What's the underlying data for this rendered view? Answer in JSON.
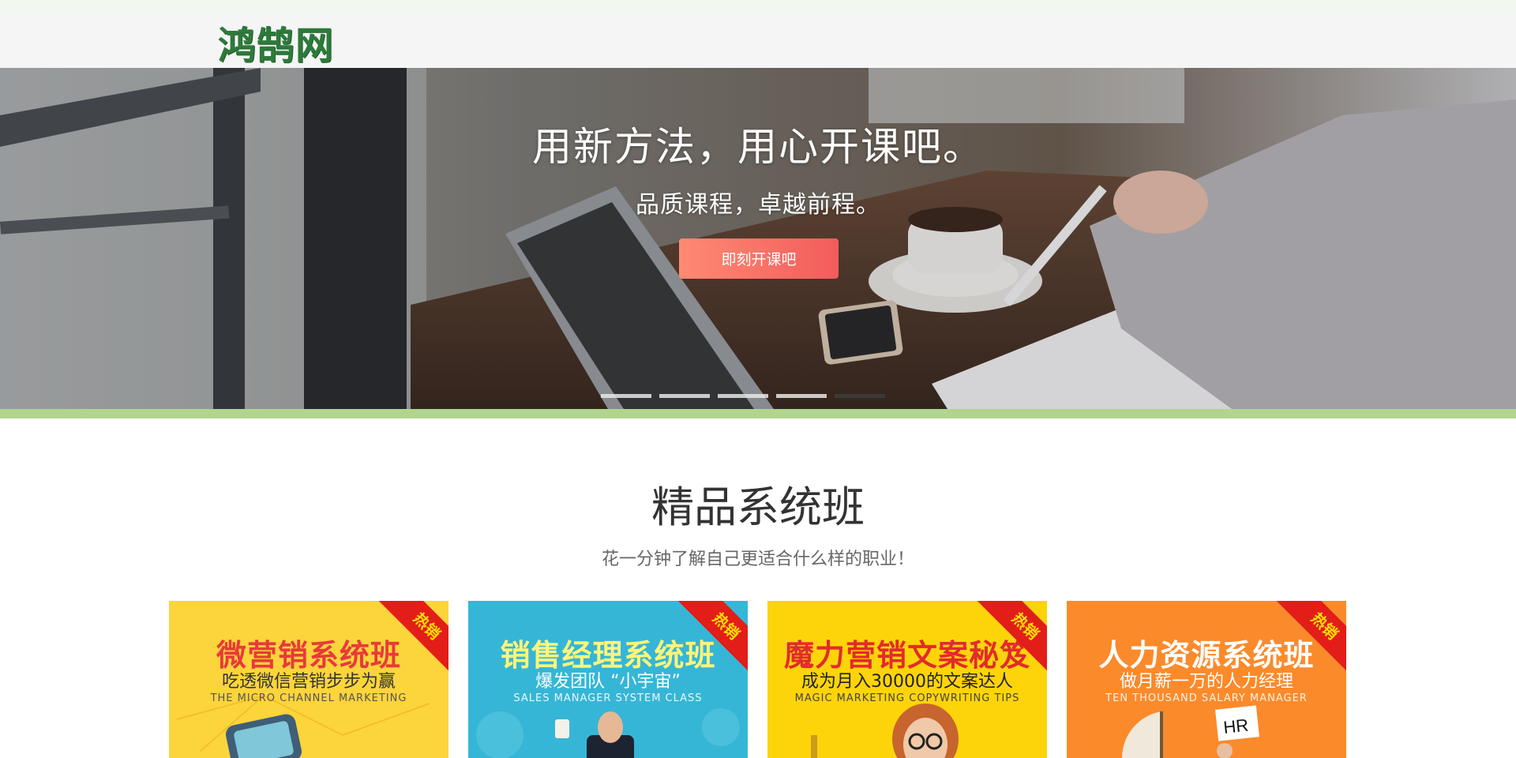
{
  "header": {
    "logo_text": "鸿鹄网"
  },
  "hero": {
    "title": "用新方法，用心开课吧。",
    "subtitle": "品质课程，卓越前程。",
    "cta_label": "即刻开课吧",
    "slides_count": 5,
    "active_slide": 5
  },
  "section": {
    "title": "精品系统班",
    "subtitle": "花一分钟了解自己更适合什么样的职业！"
  },
  "courses": [
    {
      "title": "微营销系统班",
      "subtitle": "吃透微信营销步步为赢",
      "english": "THE MICRO CHANNEL MARKETING",
      "badge": "热销",
      "bg": "#fcd43c",
      "title_color": "#e83a3a",
      "sub_color": "#333333"
    },
    {
      "title": "销售经理系统班",
      "subtitle": "爆发团队 “小宇宙”",
      "english": "SALES MANAGER SYSTEM CLASS",
      "badge": "热销",
      "bg": "#36b6d6",
      "title_color": "#fff57a",
      "sub_color": "#ffffff"
    },
    {
      "title": "魔力营销文案秘笈",
      "subtitle": "成为月入30000的文案达人",
      "english": "MAGIC MARKETING COPYWRITING TIPS",
      "badge": "热销",
      "bg": "#fdd40a",
      "title_color": "#e22b2b",
      "sub_color": "#222222"
    },
    {
      "title": "人力资源系统班",
      "subtitle": "做月薪一万的人力经理",
      "english": "TEN THOUSAND SALARY MANAGER",
      "badge": "热销",
      "bg": "#fb8a2b",
      "title_color": "#ffffff",
      "sub_color": "#ffffff"
    }
  ]
}
